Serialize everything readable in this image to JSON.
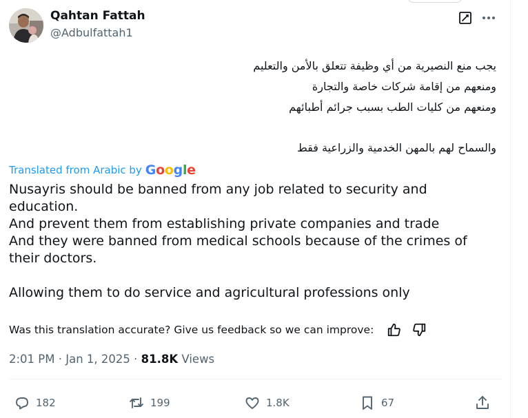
{
  "tweet": {
    "author_name": "Qahtan Fattah",
    "author_handle": "@Adbulfattah1",
    "arabic_lines": [
      "يجب منع النصيرية من أي وظيفة تتعلق بالأمن والتعليم",
      "ومنعهم من إقامة شركات خاصة والتجارة",
      "ومنعهم من كليات الطب بسبب جرائم أطبائهم",
      "والسماح لهم بالمهن الخدمية والزراعية فقط"
    ],
    "translated_from_label": "Translated from Arabic by",
    "translator_logo": "Google",
    "translation_lines": [
      "Nusayris should be banned from any job related to security and",
      "education.",
      "And prevent them from establishing private companies and trade",
      "And they were banned from medical schools because of the crimes of",
      "their doctors.",
      "Allowing them to do service and agricultural professions only"
    ],
    "feedback_prompt": "Was this translation accurate? Give us feedback so we can improve:",
    "time": "2:01 PM",
    "separator": "·",
    "date": "Jan 1, 2025",
    "views_count": "81.8K",
    "views_label": "Views"
  },
  "actions": {
    "replies": "182",
    "reposts": "199",
    "likes": "1.8K",
    "bookmarks": "67"
  },
  "icons": {
    "grok": "grok-icon",
    "more": "more-dots-icon",
    "thumbs_up": "thumbs-up-icon",
    "thumbs_down": "thumbs-down-icon",
    "reply": "reply-icon",
    "repost": "repost-icon",
    "like": "heart-icon",
    "bookmark": "bookmark-icon",
    "share": "share-icon"
  },
  "colors": {
    "text": "#0f1419",
    "secondary": "#536471",
    "link_blue": "#1d9bf0",
    "google_blue": "#4285f4",
    "google_red": "#ea4335",
    "google_yellow": "#fbbc05",
    "google_green": "#34a853"
  }
}
